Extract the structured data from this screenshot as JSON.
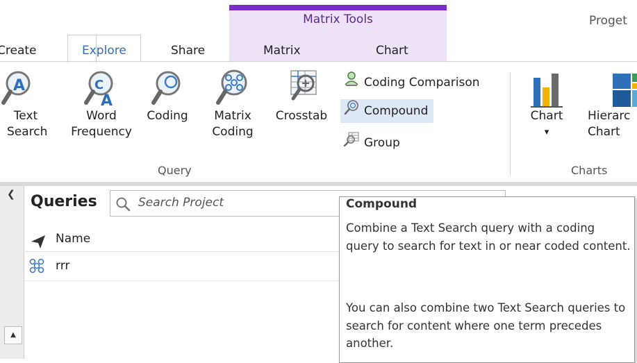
{
  "app": {
    "title": "Proget"
  },
  "contextual": {
    "label": "Matrix Tools",
    "color": "#7b2fc8"
  },
  "tabs": [
    "Create",
    "Explore",
    "Share",
    "Matrix",
    "Chart"
  ],
  "ribbon": {
    "query_buttons": [
      {
        "label": "Text\nSearch",
        "icon": "text-search-icon"
      },
      {
        "label": "Word\nFrequency",
        "icon": "word-frequency-icon"
      },
      {
        "label": "Coding",
        "icon": "coding-query-icon"
      },
      {
        "label": "Matrix\nCoding",
        "icon": "matrix-coding-icon"
      },
      {
        "label": "Crosstab",
        "icon": "crosstab-icon"
      }
    ],
    "small_buttons": [
      {
        "label": "Coding Comparison",
        "icon": "coding-comparison-icon"
      },
      {
        "label": "Compound",
        "icon": "compound-icon"
      },
      {
        "label": "Group",
        "icon": "group-icon"
      }
    ],
    "query_group_label": "Query",
    "chart_button": {
      "label": "Chart",
      "arrow": "▾"
    },
    "hierarchy_button": {
      "label": "Hierarc\nChart"
    },
    "charts_group_label": "Charts"
  },
  "pane": {
    "title": "Queries",
    "search_placeholder": "Search Project",
    "column_name": "Name",
    "rows": [
      {
        "name": "rrr",
        "icon": "matrix-coding-icon"
      }
    ]
  },
  "tooltip": {
    "title": "Compound",
    "para1": "Combine a Text Search query with a coding query to search for text in or near coded content.",
    "para2": "You can also combine two Text Search queries to search for content where one term precedes another."
  },
  "colors": {
    "accent": "#2f6fb7",
    "icon_blue": "#3b7cc4",
    "highlight": "#dce8f5"
  }
}
